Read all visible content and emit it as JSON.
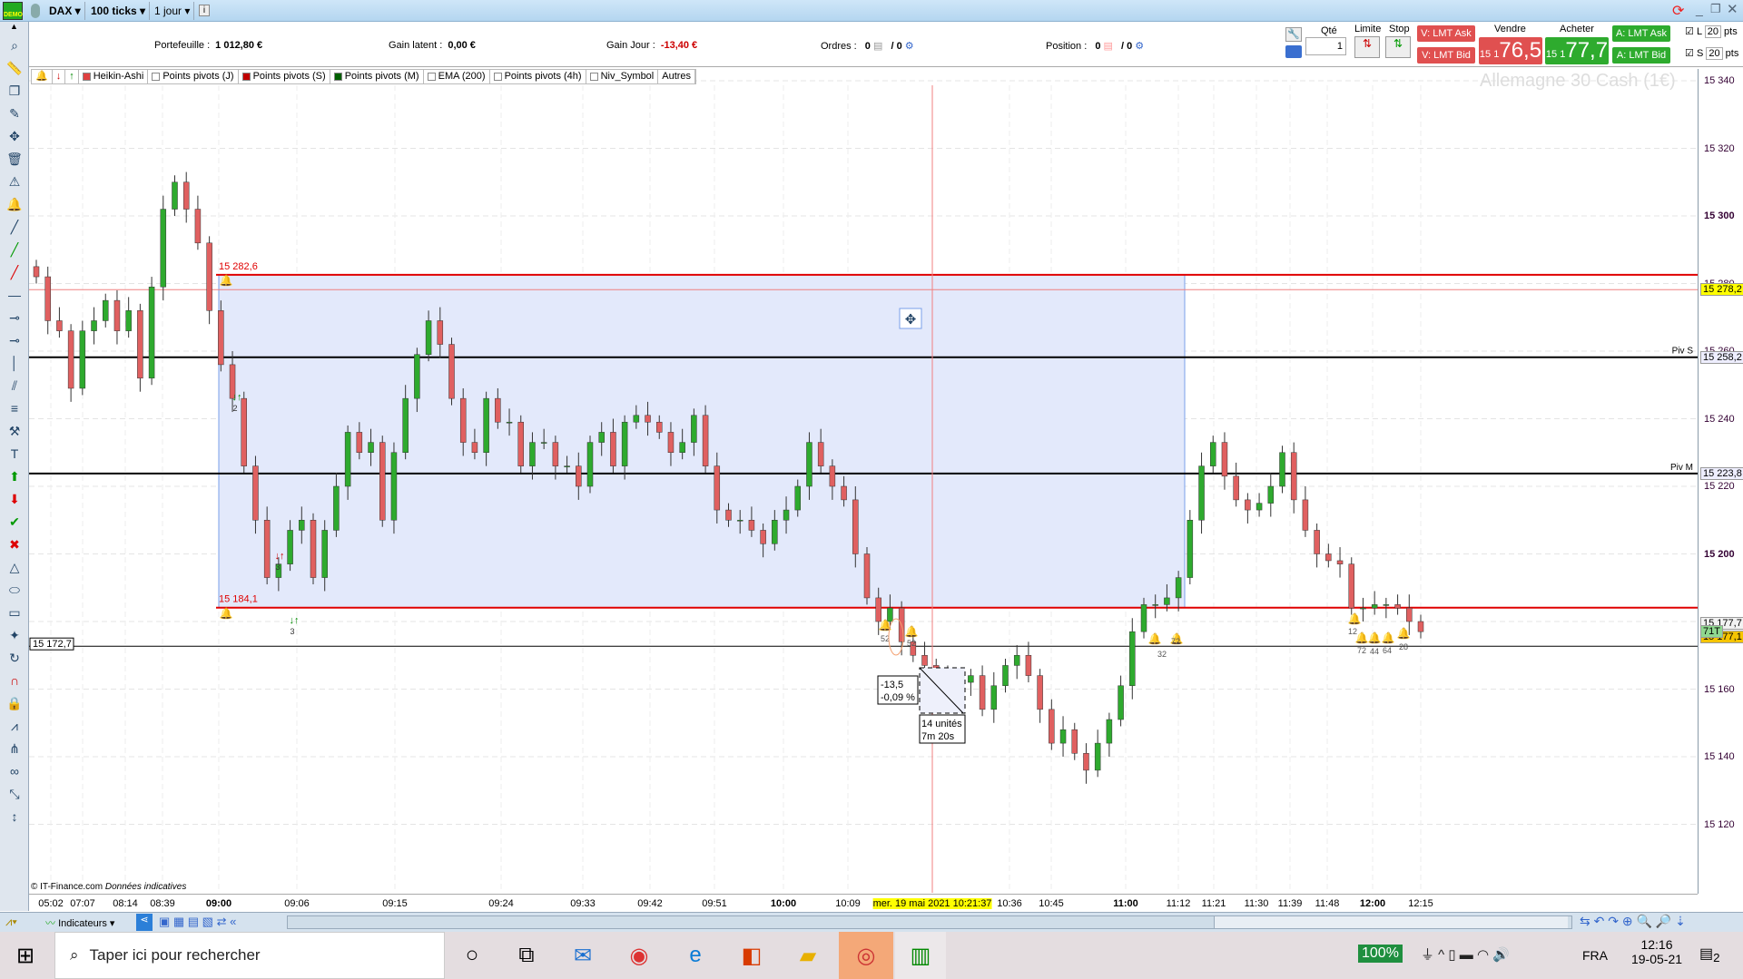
{
  "topbar": {
    "symbol": "DAX",
    "ticks": "100 ticks",
    "period": "1 jour",
    "info_icon": "i",
    "demo_label": "DEMO"
  },
  "infobar": {
    "portefeuille_label": "Portefeuille :",
    "portefeuille": "1 012,80 €",
    "gain_latent_label": "Gain latent :",
    "gain_latent": "0,00 €",
    "gain_jour_label": "Gain Jour :",
    "gain_jour": "-13,40 €",
    "ordres_label": "Ordres :",
    "ordres": "0",
    "ordres2": "/ 0",
    "position_label": "Position :",
    "position": "0",
    "position2": "/ 0"
  },
  "trade": {
    "qte_label": "Qté",
    "qte": "1",
    "limite_label": "Limite",
    "stop_label": "Stop",
    "v_lmt_ask": "V: LMT Ask",
    "v_lmt_bid": "V: LMT Bid",
    "vendre_label": "Vendre",
    "vendre_prefix": "15 1",
    "vendre": "76,5",
    "acheter_label": "Acheter",
    "acheter_prefix": "15 1",
    "acheter": "77,7",
    "a_lmt_ask": "A: LMT Ask",
    "a_lmt_bid": "A: LMT Bid",
    "l_label": "L",
    "l_value": "20",
    "s_label": "S",
    "s_value": "20",
    "pts": "pts"
  },
  "tabs": [
    {
      "label": "Heikin-Ashi",
      "color": "#e04040"
    },
    {
      "label": "Points pivots (J)"
    },
    {
      "label": "Points pivots (S)",
      "color": "#c00000"
    },
    {
      "label": "Points pivots (M)",
      "color": "#006000"
    },
    {
      "label": "EMA (200)"
    },
    {
      "label": "Points pivots (4h)"
    },
    {
      "label": "Niv_Symbol"
    },
    {
      "label": "Autres"
    }
  ],
  "left_tools": [
    "search-icon",
    "ruler-icon",
    "copy-icon",
    "pencil-icon",
    "move-icon",
    "trash-icon",
    "alert-icon",
    "bell-icon",
    "line-icon",
    "trend-line-icon",
    "red-line-icon",
    "horizontal-line-icon",
    "segment-icon",
    "ray-icon",
    "vertical-line-icon",
    "channel-icon",
    "fibonacci-icon",
    "tools-icon",
    "text-icon",
    "buy-arrow-icon",
    "sell-arrow-icon",
    "check-icon",
    "cross-icon",
    "triangle-icon",
    "ellipse-icon",
    "rectangle-icon",
    "stars-icon",
    "rotate-icon",
    "magnet-icon",
    "lock-icon",
    "zigzag-icon",
    "pitchfork-icon",
    "glasses-icon",
    "brush-icon",
    "measure-icon"
  ],
  "chart_data": {
    "type": "candlestick",
    "title": "Allemagne 30 Cash (1€)",
    "ylim": [
      15110,
      15345
    ],
    "y_ticks": [
      "15 340",
      "15 320",
      "15 300",
      "15 280",
      "15 260",
      "15 240",
      "15 220",
      "15 200",
      "15 180",
      "15 160",
      "15 140",
      "15 120"
    ],
    "y_tick_values": [
      15340,
      15320,
      15300,
      15280,
      15260,
      15240,
      15220,
      15200,
      15180,
      15160,
      15140,
      15120
    ],
    "x_ticks": [
      "05:02",
      "07:07",
      "08:14",
      "08:39",
      "09:00",
      "09:06",
      "09:15",
      "09:24",
      "09:33",
      "09:42",
      "09:51",
      "10:00",
      "10:09",
      "10:36",
      "10:45",
      "11:00",
      "11:12",
      "11:21",
      "11:30",
      "11:39",
      "11:48",
      "12:00",
      "12:15"
    ],
    "cursor_date": "mer. 19 mai 2021 10:21:37",
    "closes": [
      15282,
      15269,
      15266,
      15249,
      15266,
      15269,
      15275,
      15266,
      15272,
      15252,
      15279,
      15302,
      15310,
      15302,
      15292,
      15272,
      15256,
      15246,
      15226,
      15210,
      15193,
      15197,
      15207,
      15210,
      15193,
      15207,
      15220,
      15236,
      15230,
      15233,
      15210,
      15230,
      15246,
      15259,
      15269,
      15262,
      15246,
      15233,
      15230,
      15246,
      15239,
      15239,
      15226,
      15233,
      15233,
      15226,
      15226,
      15220,
      15233,
      15236,
      15226,
      15239,
      15241,
      15239,
      15236,
      15230,
      15233,
      15241,
      15226,
      15213,
      15210,
      15210,
      15207,
      15203,
      15210,
      15213,
      15220,
      15233,
      15226,
      15220,
      15216,
      15200,
      15187,
      15180,
      15184,
      15174,
      15170,
      15167,
      15164,
      15157,
      15162,
      15164,
      15154,
      15161,
      15167,
      15170,
      15164,
      15154,
      15144,
      15148,
      15141,
      15136,
      15144,
      15151,
      15161,
      15177,
      15185,
      15185,
      15187,
      15193,
      15210,
      15226,
      15233,
      15223,
      15216,
      15213,
      15215,
      15220,
      15230,
      15216,
      15207,
      15200,
      15198,
      15197,
      15184,
      15184,
      15185,
      15185,
      15184,
      15180,
      15177
    ],
    "levels": [
      {
        "label": "15 282,6",
        "value": 15282.6,
        "color": "#e00000"
      },
      {
        "label": "15 184,1",
        "value": 15184.1,
        "color": "#e00000"
      },
      {
        "label": "15 278,2",
        "value": 15278.2,
        "color": "#f08080",
        "tag_color": "#ffff00"
      },
      {
        "label": "Piv S",
        "value": 15258.2,
        "color": "#000000",
        "tag": "15 258,2"
      },
      {
        "label": "Piv M",
        "value": 15223.8,
        "color": "#000000",
        "tag": "15 223,8"
      },
      {
        "label": "15 172,7",
        "value": 15172.7,
        "color": "#000000"
      }
    ],
    "bid": "15 177,7",
    "ask": "15 177,1",
    "ticks_left": "71T",
    "measure": {
      "change": "-13,5",
      "pct": "-0,09 %",
      "units": "14 unités",
      "duration": "7m 20s"
    },
    "alerts": [
      "52",
      "52",
      "72",
      "32",
      "12",
      "72",
      "44",
      "64",
      "28"
    ],
    "arrow_labels": [
      "2",
      "3",
      "3"
    ],
    "source": "© IT-Finance.com",
    "source_note": "Données indicatives"
  },
  "bottom": {
    "indicateurs": "Indicateurs"
  },
  "taskbar": {
    "search_placeholder": "Taper ici pour rechercher",
    "battery": "100%",
    "lang": "FRA",
    "time": "12:16",
    "date": "19-05-21",
    "notif": "2"
  }
}
